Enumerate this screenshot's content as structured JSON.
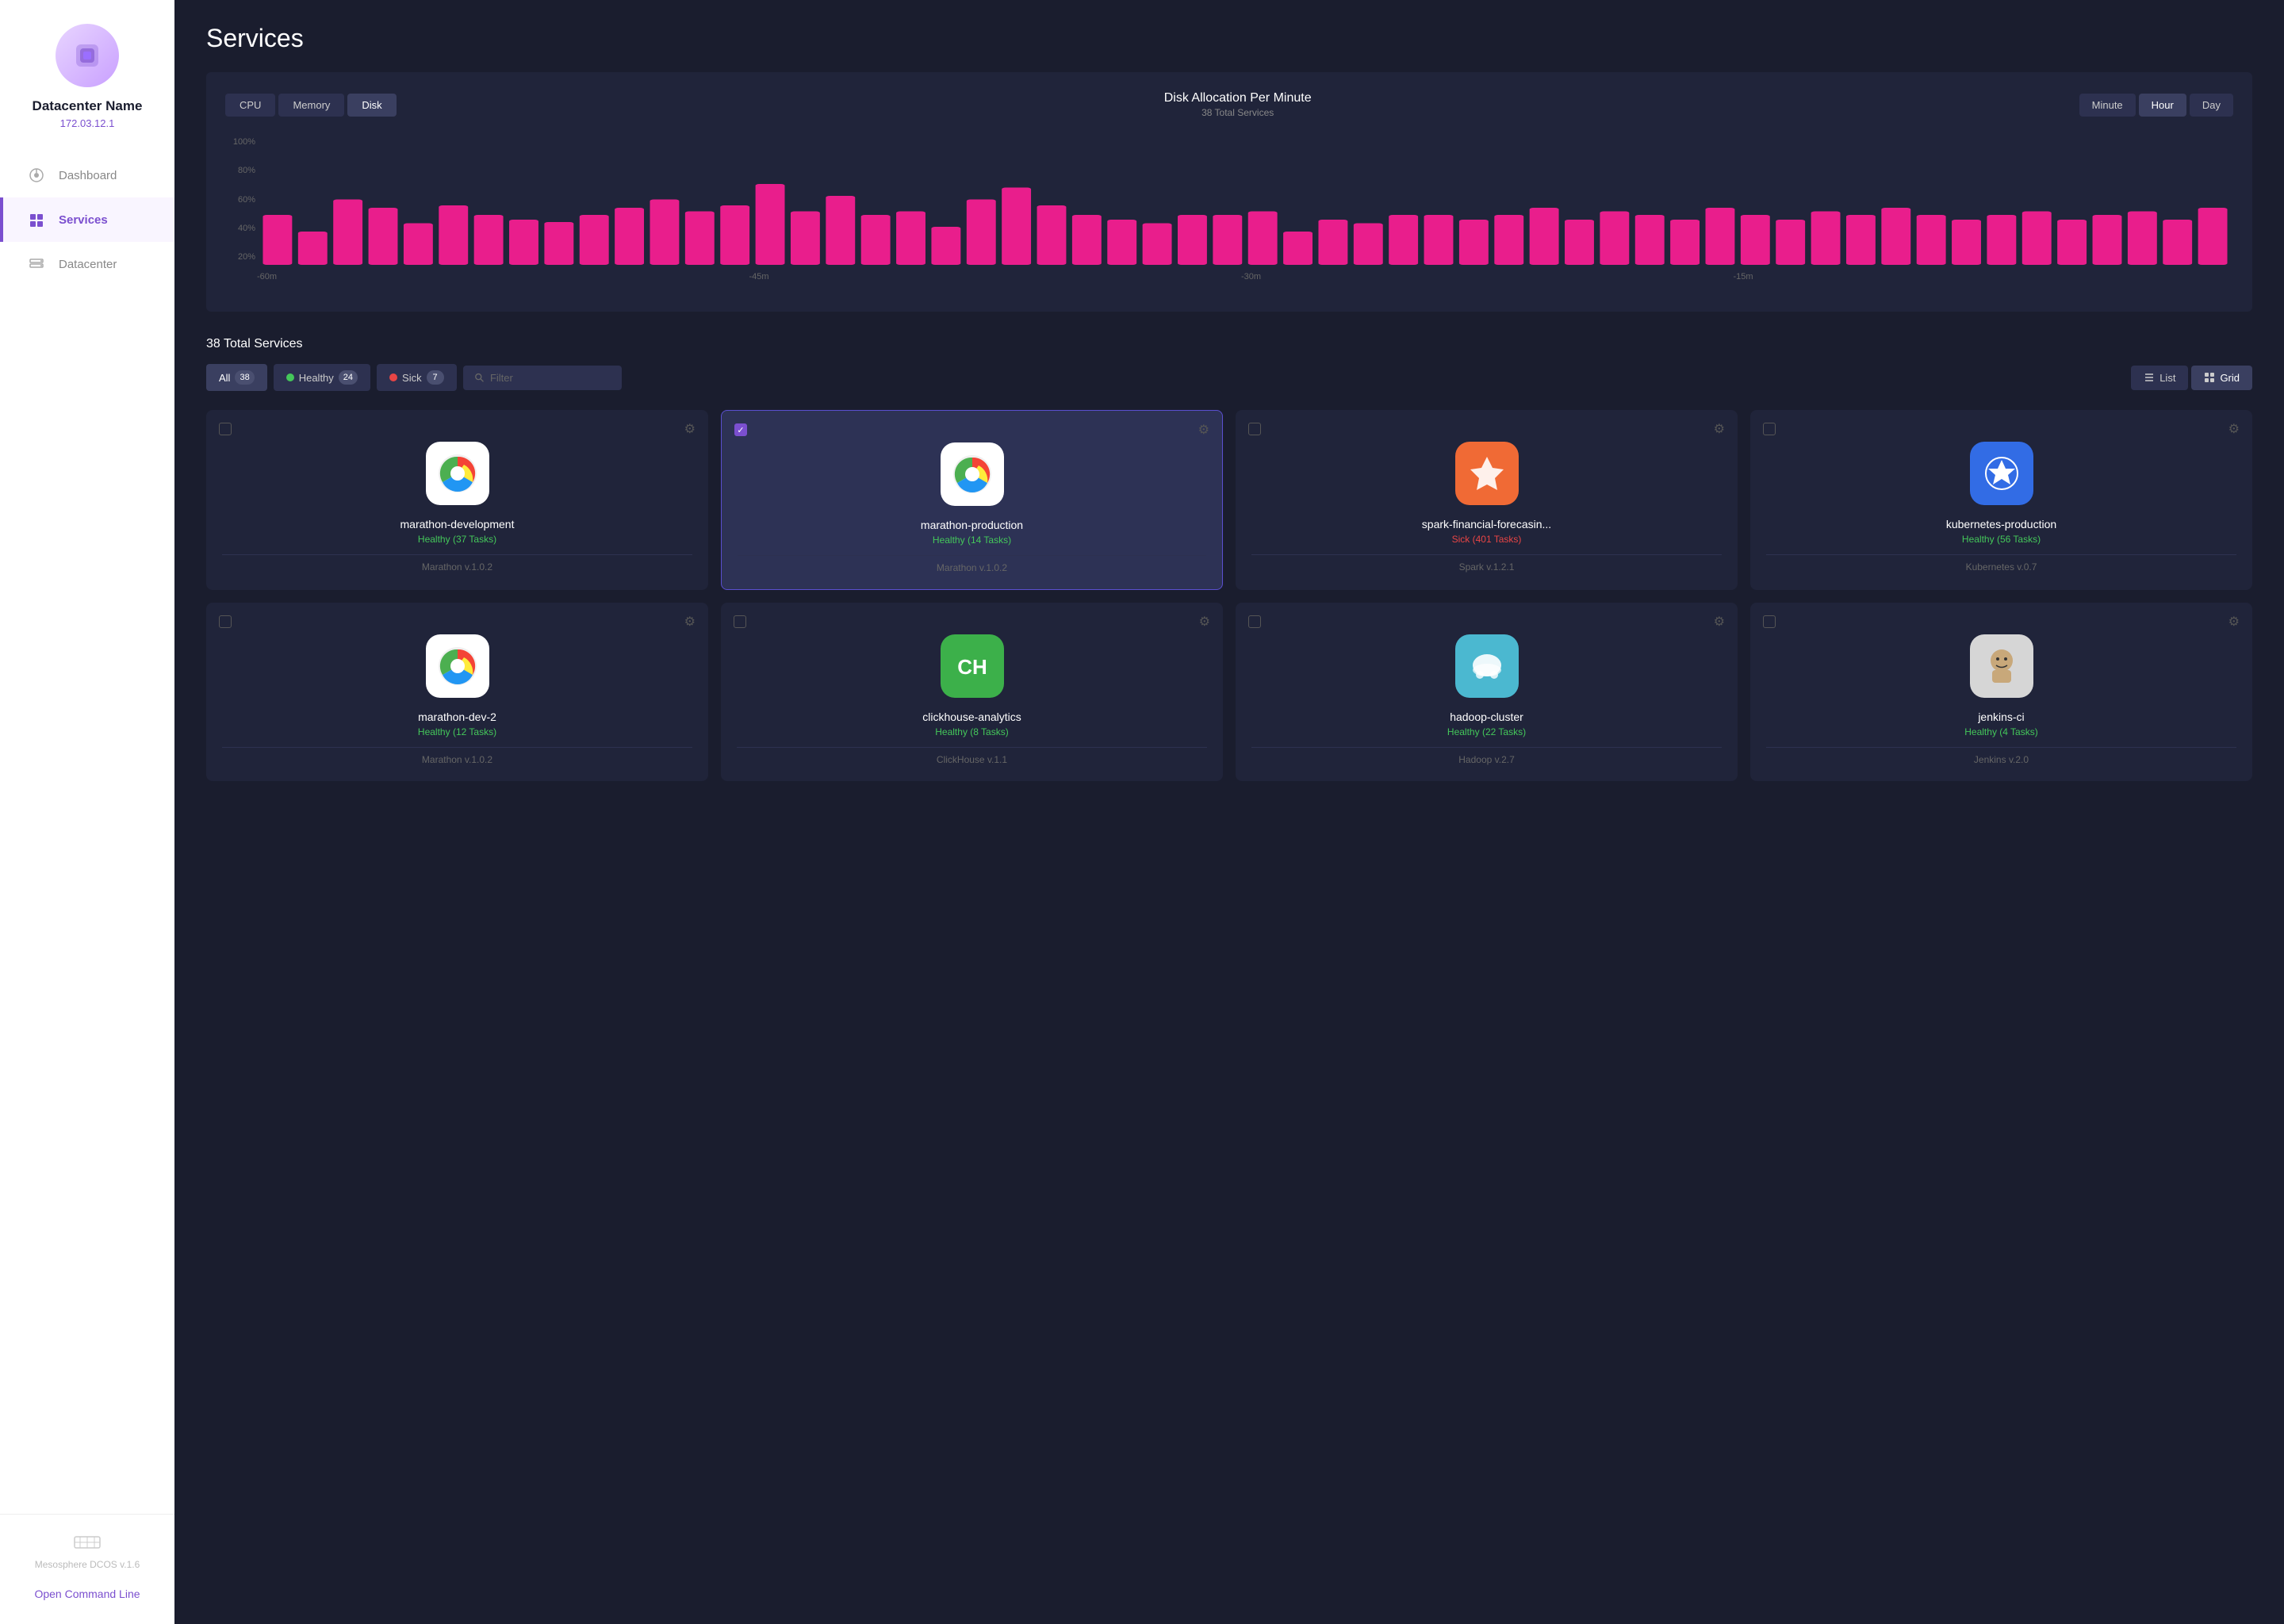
{
  "sidebar": {
    "datacenter_name": "Datacenter Name",
    "ip": "172.03.12.1",
    "nav_items": [
      {
        "id": "dashboard",
        "label": "Dashboard",
        "active": false
      },
      {
        "id": "services",
        "label": "Services",
        "active": true
      },
      {
        "id": "datacenter",
        "label": "Datacenter",
        "active": false
      }
    ],
    "mesosphere_label": "Mesosphere DCOS v.1.6",
    "open_command_line": "Open Command Line"
  },
  "main": {
    "page_title": "Services",
    "chart": {
      "tabs": [
        "CPU",
        "Memory",
        "Disk"
      ],
      "active_tab": "Disk",
      "title": "Disk Allocation Per Minute",
      "subtitle": "38 Total Services",
      "time_tabs": [
        "Minute",
        "Hour",
        "Day"
      ],
      "active_time_tab": "Hour",
      "y_labels": [
        "100%",
        "80%",
        "60%",
        "40%",
        "20%"
      ],
      "x_labels": [
        "-60m",
        "-45m",
        "-30m",
        "-15m"
      ],
      "bars": [
        42,
        28,
        55,
        48,
        35,
        50,
        42,
        38,
        36,
        42,
        48,
        55,
        45,
        50,
        68,
        45,
        58,
        42,
        45,
        32,
        55,
        65,
        50,
        42,
        38,
        35,
        42,
        42,
        45,
        28,
        38,
        35,
        42,
        42,
        38,
        42,
        48,
        38,
        45,
        42,
        38,
        48,
        42,
        38,
        45,
        42,
        48,
        42,
        38,
        42,
        45,
        38,
        42,
        45,
        38,
        48
      ]
    },
    "services": {
      "total_label": "38 Total Services",
      "filter_all_label": "All",
      "filter_all_count": "38",
      "filter_healthy_label": "Healthy",
      "filter_healthy_count": "24",
      "filter_sick_label": "Sick",
      "filter_sick_count": "7",
      "filter_placeholder": "Filter",
      "view_list_label": "List",
      "view_grid_label": "Grid",
      "cards": [
        {
          "id": "marathon-development",
          "name": "marathon-development",
          "status": "Healthy (37 Tasks)",
          "status_type": "healthy",
          "version": "Marathon v.1.0.2",
          "icon_type": "marathon",
          "selected": false
        },
        {
          "id": "marathon-production",
          "name": "marathon-production",
          "status": "Healthy (14 Tasks)",
          "status_type": "healthy",
          "version": "Marathon v.1.0.2",
          "icon_type": "marathon",
          "selected": true
        },
        {
          "id": "spark-financial-forecasin",
          "name": "spark-financial-forecasin...",
          "status": "Sick (401 Tasks)",
          "status_type": "sick",
          "version": "Spark v.1.2.1",
          "icon_type": "spark",
          "selected": false
        },
        {
          "id": "kubernetes-production",
          "name": "kubernetes-production",
          "status": "Healthy (56 Tasks)",
          "status_type": "healthy",
          "version": "Kubernetes v.0.7",
          "icon_type": "kubernetes",
          "selected": false
        },
        {
          "id": "service-5",
          "name": "marathon-dev-2",
          "status": "Healthy (12 Tasks)",
          "status_type": "healthy",
          "version": "Marathon v.1.0.2",
          "icon_type": "marathon",
          "selected": false
        },
        {
          "id": "service-6",
          "name": "clickhouse-analytics",
          "status": "Healthy (8 Tasks)",
          "status_type": "healthy",
          "version": "ClickHouse v.1.1",
          "icon_type": "ch",
          "selected": false
        },
        {
          "id": "service-7",
          "name": "hadoop-cluster",
          "status": "Healthy (22 Tasks)",
          "status_type": "healthy",
          "version": "Hadoop v.2.7",
          "icon_type": "hadoop",
          "selected": false
        },
        {
          "id": "service-8",
          "name": "jenkins-ci",
          "status": "Healthy (4 Tasks)",
          "status_type": "healthy",
          "version": "Jenkins v.2.0",
          "icon_type": "jenkins",
          "selected": false
        }
      ]
    }
  },
  "colors": {
    "accent_purple": "#7b4fcf",
    "healthy_green": "#44c75a",
    "sick_red": "#e84545",
    "bar_pink": "#e91e8c",
    "bg_dark": "#1a1d2e",
    "bg_card": "#20243a"
  }
}
